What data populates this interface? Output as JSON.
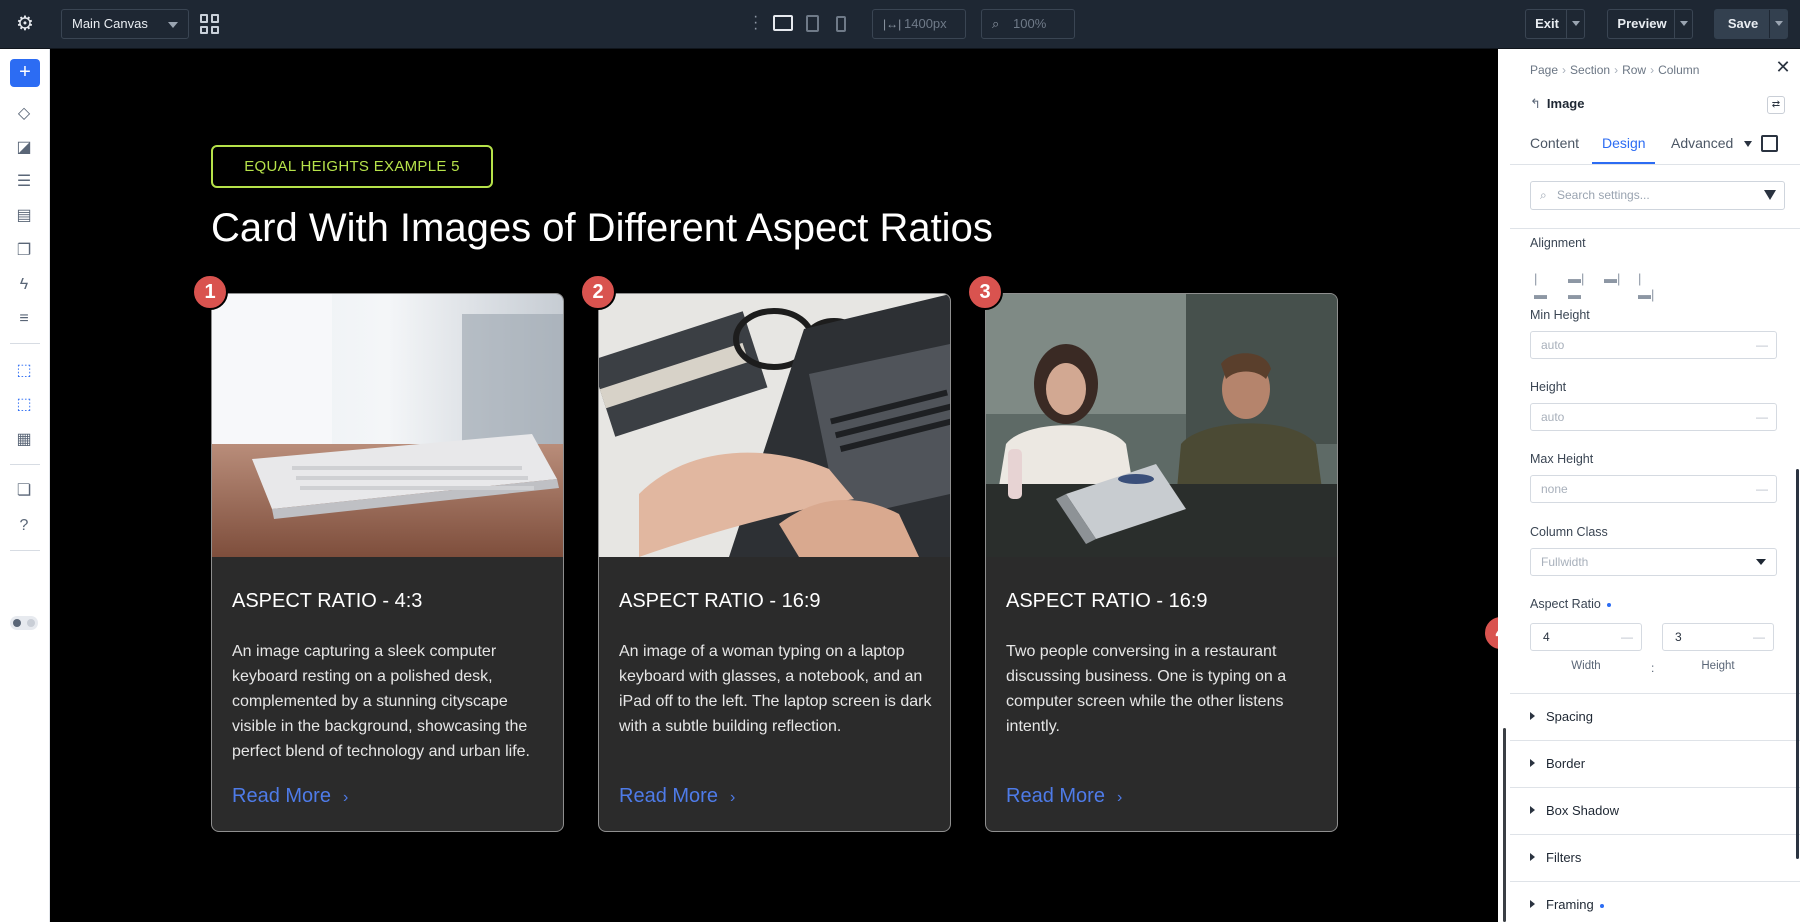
{
  "topbar": {
    "canvas_label": "Main Canvas",
    "width_value": "1400px",
    "zoom_value": "100%",
    "exit_label": "Exit",
    "preview_label": "Preview",
    "save_label": "Save"
  },
  "page": {
    "pill_label": "EQUAL HEIGHTS EXAMPLE 5",
    "headline": "Card With Images of Different Aspect Ratios",
    "cards": [
      {
        "badge": "1",
        "title": "ASPECT RATIO - 4:3",
        "desc": "An image capturing a sleek computer keyboard resting on a polished desk, complemented by a stunning cityscape visible in the background, showcasing the perfect blend of technology and urban life.",
        "link": "Read More"
      },
      {
        "badge": "2",
        "title": "ASPECT RATIO - 16:9",
        "desc": "An image of a woman typing on a laptop keyboard with glasses, a notebook, and an iPad off to the left. The laptop screen is dark with a subtle building reflection.",
        "link": "Read More"
      },
      {
        "badge": "3",
        "title": "ASPECT RATIO - 16:9",
        "desc": "Two people conversing in a restaurant discussing business. One is typing on a computer screen while the other listens intently.",
        "link": "Read More"
      }
    ],
    "panel_badge": "4"
  },
  "panel": {
    "breadcrumbs": [
      "Page",
      "Section",
      "Row",
      "Column"
    ],
    "module_title": "Image",
    "tabs": [
      "Content",
      "Design",
      "Advanced"
    ],
    "search_placeholder": "Search settings...",
    "alignment_label": "Alignment",
    "min_height_label": "Min Height",
    "min_height_value": "auto",
    "height_label": "Height",
    "height_value": "auto",
    "max_height_label": "Max Height",
    "max_height_value": "none",
    "column_class_label": "Column Class",
    "column_class_value": "Fullwidth",
    "aspect_ratio_label": "Aspect Ratio",
    "aspect_width": "4",
    "aspect_height": "3",
    "width_caption": "Width",
    "height_caption": "Height",
    "colon": ":",
    "sections": [
      "Spacing",
      "Border",
      "Box Shadow",
      "Filters",
      "Framing"
    ]
  },
  "colors": {
    "accent": "#2c6cf3",
    "pill_green": "#b6e24a",
    "badge_red": "#d9534f",
    "link_blue": "#4e7be8"
  }
}
